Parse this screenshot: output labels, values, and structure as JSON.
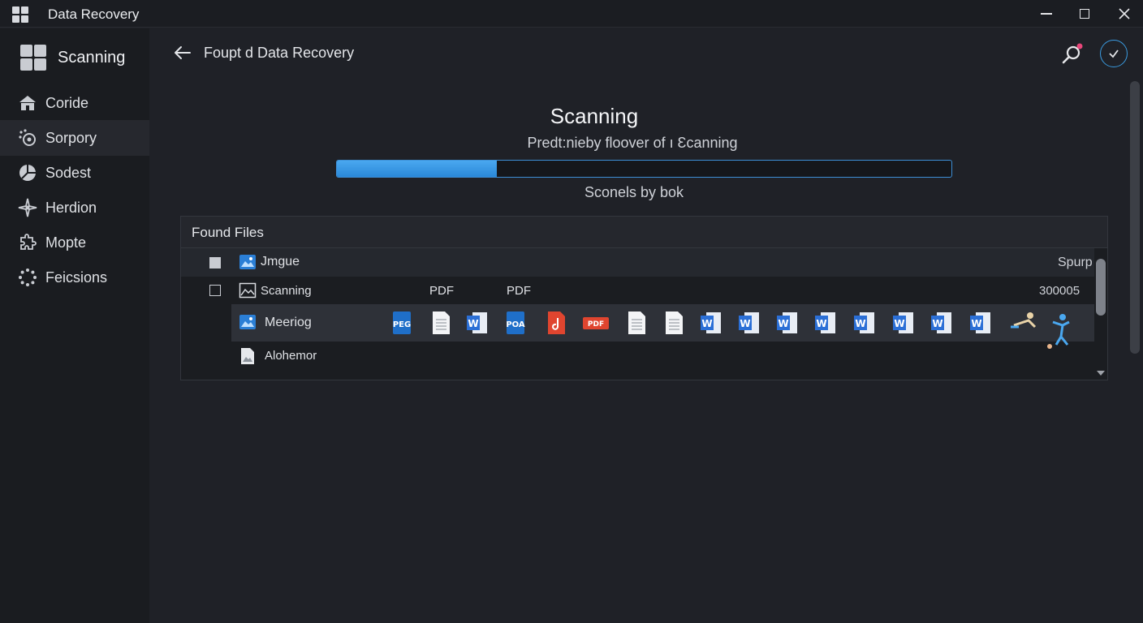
{
  "window": {
    "title": "Data Recovery"
  },
  "sidebar": {
    "header": "Scanning",
    "items": [
      {
        "label": "Coride",
        "icon": "home-icon"
      },
      {
        "label": "Sorpory",
        "icon": "scan-icon",
        "active": true
      },
      {
        "label": "Sodest",
        "icon": "pie-icon"
      },
      {
        "label": "Herdion",
        "icon": "sparkle-icon"
      },
      {
        "label": "Mopte",
        "icon": "puzzle-icon"
      },
      {
        "label": "Feicsions",
        "icon": "dots-ring-icon"
      }
    ]
  },
  "header": {
    "title": "Foupt d Data Recovery"
  },
  "scan": {
    "title": "Scanning",
    "subtitle": "Predt:nieby floover of ı Ɛcanning",
    "progress": 0.26,
    "status": "Sconels by bok"
  },
  "files": {
    "title": "Found Files",
    "header_row": {
      "name": "Jmgue",
      "right": "Spurp"
    },
    "rows": [
      {
        "name": "Scanning",
        "col2": "PDF",
        "col3": "PDF",
        "right": "300005"
      },
      {
        "name": "Meeriog"
      },
      {
        "name": "Alohemor"
      }
    ],
    "strip_icons": [
      "PEG",
      "doc",
      "W",
      "POA",
      "pdf-red",
      "PDF",
      "doc",
      "doc",
      "W",
      "W",
      "W",
      "W",
      "W",
      "W",
      "W",
      "W"
    ]
  },
  "colors": {
    "accent": "#3a9be0",
    "pdf_red": "#e0452f",
    "word_blue": "#2b6fd6"
  }
}
